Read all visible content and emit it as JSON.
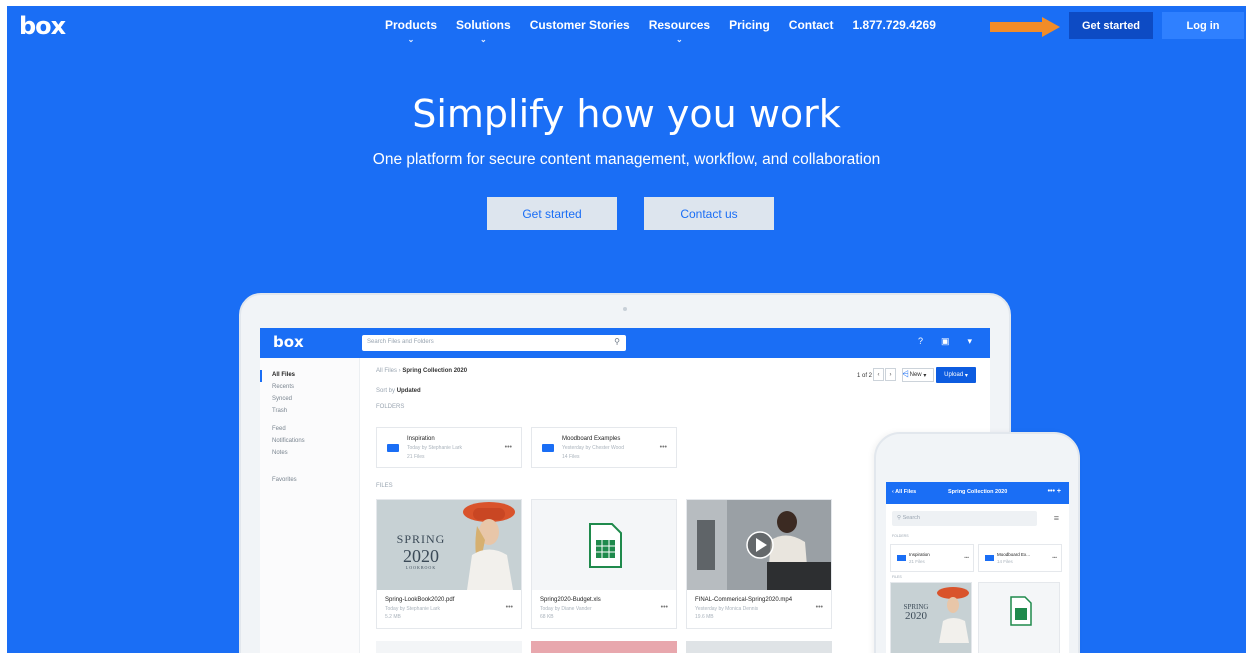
{
  "header": {
    "logo": "box",
    "nav": [
      {
        "label": "Products",
        "has_dropdown": true
      },
      {
        "label": "Solutions",
        "has_dropdown": true
      },
      {
        "label": "Customer Stories",
        "has_dropdown": false
      },
      {
        "label": "Resources",
        "has_dropdown": true
      },
      {
        "label": "Pricing",
        "has_dropdown": false
      },
      {
        "label": "Contact",
        "has_dropdown": false
      },
      {
        "label": "1.877.729.4269",
        "has_dropdown": false
      }
    ],
    "get_started": "Get started",
    "login": "Log in",
    "arrow_color": "#f28c28"
  },
  "hero": {
    "title": "Simplify how you work",
    "subtitle": "One platform for secure content management, workflow, and collaboration",
    "cta_primary": "Get started",
    "cta_secondary": "Contact us"
  },
  "app": {
    "logo": "box",
    "search_placeholder": "Search Files and Folders",
    "sidebar": [
      {
        "label": "All Files",
        "active": true
      },
      {
        "label": "Recents",
        "active": false
      },
      {
        "label": "Synced",
        "active": false
      },
      {
        "label": "Trash",
        "active": false
      },
      {
        "label": "Feed",
        "active": false
      },
      {
        "label": "Notifications",
        "active": false
      },
      {
        "label": "Notes",
        "active": false
      },
      {
        "label": "Favorites",
        "active": false
      }
    ],
    "breadcrumb_root": "All Files",
    "breadcrumb_current": "Spring Collection 2020",
    "sort_label": "Sort by",
    "sort_value": "Updated",
    "folders_label": "FOLDERS",
    "files_label": "FILES",
    "pager": "1 of 2",
    "new_label": "New",
    "upload_label": "Upload",
    "folders": [
      {
        "name": "Inspiration",
        "meta": "Today by Stephanie Lark",
        "count": "21 Files"
      },
      {
        "name": "Moodboard Examples",
        "meta": "Yesterday by Chester Wood",
        "count": "14 Files"
      }
    ],
    "files": [
      {
        "name": "Spring-LookBook2020.pdf",
        "meta": "Today by Stephanie Lark",
        "size": "5.2 MB"
      },
      {
        "name": "Spring2020-Budget.xls",
        "meta": "Today by Diane Vander",
        "size": "68 KB"
      },
      {
        "name": "FINAL-Commerical-Spring2020.mp4",
        "meta": "Yesterday by Monica Dennis",
        "size": "19.6 MB"
      }
    ],
    "lookbook_text": {
      "line1": "SPRING",
      "line2": "2020",
      "line3": "LOOKBOOK"
    }
  },
  "mobile": {
    "back_label": "All Files",
    "title": "Spring Collection 2020",
    "search_placeholder": "Search",
    "folders_label": "FOLDERS",
    "files_label": "FILES",
    "folders": [
      {
        "name": "Inspiration",
        "count": "21 Files"
      },
      {
        "name": "Moodboard Ex...",
        "count": "14 Files"
      }
    ]
  }
}
